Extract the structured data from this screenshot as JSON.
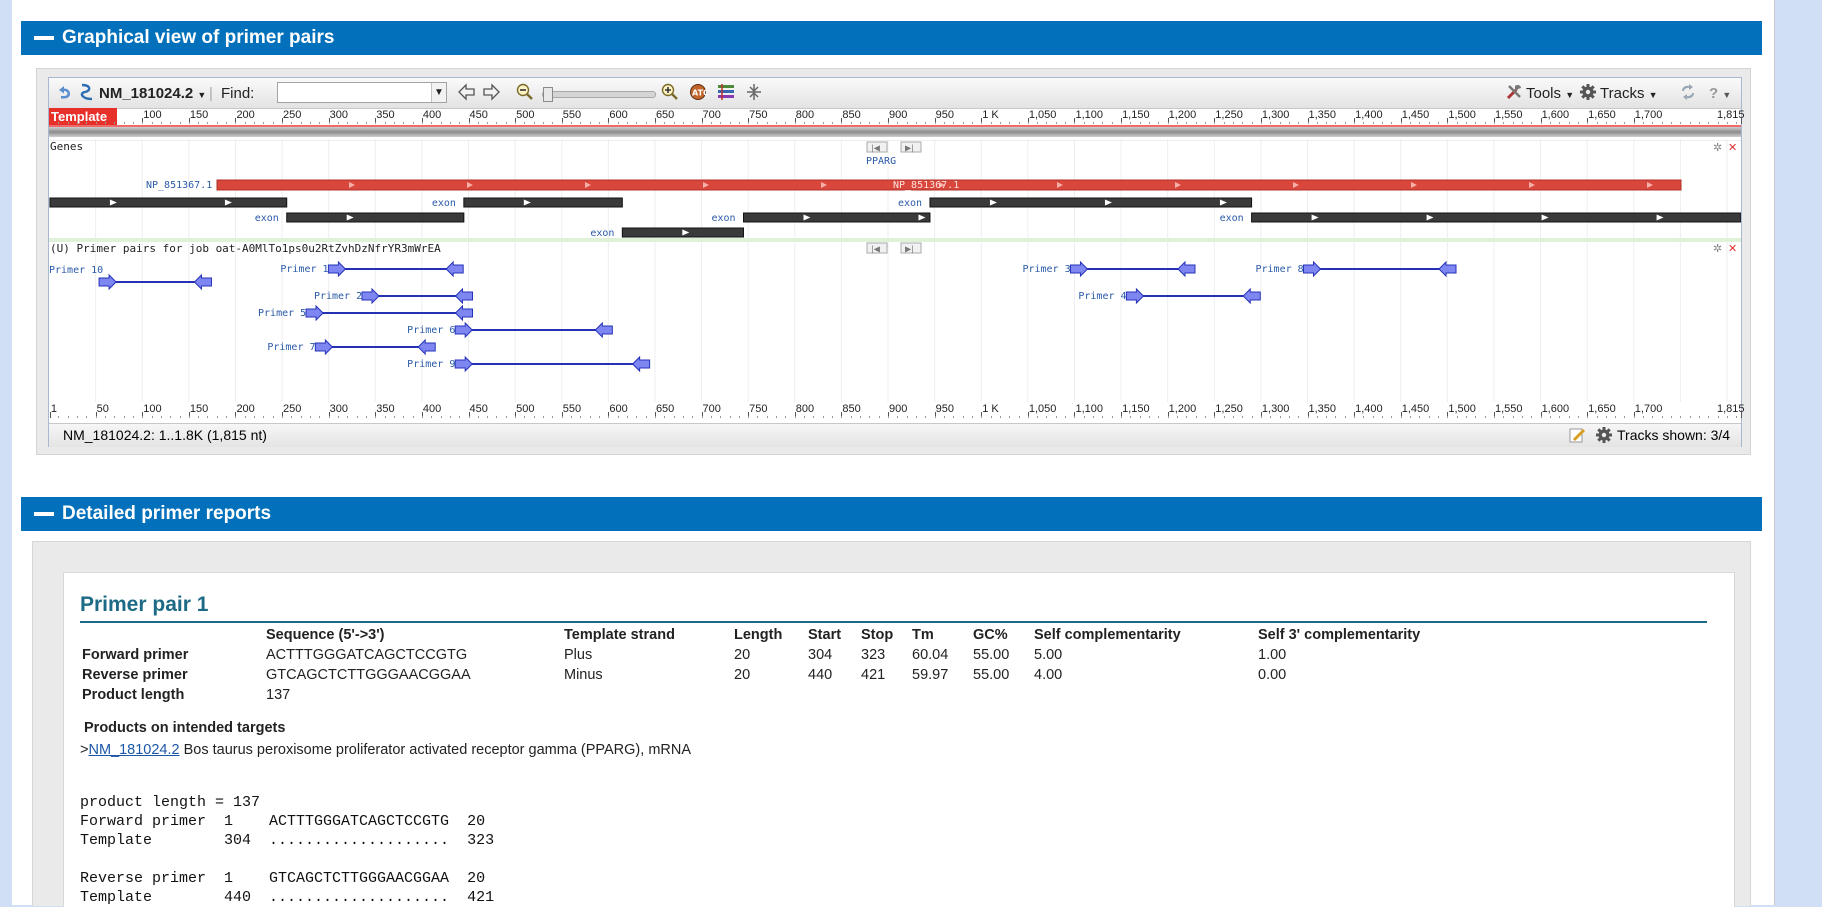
{
  "sections": {
    "graphical_title": "Graphical view of primer pairs",
    "detailed_title": "Detailed primer reports"
  },
  "toolbar": {
    "accession": "NM_181024.2",
    "find_label": "Find:",
    "find_value": "",
    "tools_label": "Tools",
    "tracks_label": "Tracks",
    "help_label": "?"
  },
  "ruler": {
    "template_label": "Template",
    "top_ticks": [
      "100",
      "150",
      "200",
      "250",
      "300",
      "350",
      "400",
      "450",
      "500",
      "550",
      "600",
      "650",
      "700",
      "750",
      "800",
      "850",
      "900",
      "950",
      "1 K",
      "1,050",
      "1,100",
      "1,150",
      "1,200",
      "1,250",
      "1,300",
      "1,350",
      "1,400",
      "1,450",
      "1,500",
      "1,550",
      "1,600",
      "1,650",
      "1,700",
      "1,815"
    ],
    "bottom_ticks": [
      "1",
      "50",
      "100",
      "150",
      "200",
      "250",
      "300",
      "350",
      "400",
      "450",
      "500",
      "550",
      "600",
      "650",
      "700",
      "750",
      "800",
      "850",
      "900",
      "950",
      "1 K",
      "1,050",
      "1,100",
      "1,150",
      "1,200",
      "1,250",
      "1,300",
      "1,350",
      "1,400",
      "1,450",
      "1,500",
      "1,550",
      "1,600",
      "1,650",
      "1,700",
      "1,815"
    ]
  },
  "genes_track": {
    "title": "Genes",
    "gene_label": "PPARG",
    "protein_label": "NP_851367.1",
    "protein_inner_label": "NP_851367.1",
    "exon_label": "exon"
  },
  "primer_track": {
    "title": "(U) Primer pairs for job oat-A0MlTo1ps0u2RtZvhDzNfrYR3mWrEA",
    "primers": [
      {
        "name": "Primer 10",
        "start": 58,
        "end": 170
      },
      {
        "name": "Primer 1",
        "start": 304,
        "end": 440
      },
      {
        "name": "Primer 2",
        "start": 340,
        "end": 450
      },
      {
        "name": "Primer 5",
        "start": 280,
        "end": 450
      },
      {
        "name": "Primer 6",
        "start": 440,
        "end": 600
      },
      {
        "name": "Primer 7",
        "start": 290,
        "end": 410
      },
      {
        "name": "Primer 9",
        "start": 440,
        "end": 640
      },
      {
        "name": "Primer 3",
        "start": 1100,
        "end": 1225
      },
      {
        "name": "Primer 4",
        "start": 1160,
        "end": 1295
      },
      {
        "name": "Primer 8",
        "start": 1350,
        "end": 1505
      }
    ]
  },
  "status": {
    "range_text": "NM_181024.2: 1..1.8K (1,815 nt)",
    "tracks_shown": "Tracks shown: 3/4"
  },
  "report": {
    "pair_title": "Primer pair 1",
    "headers": [
      "Sequence (5'->3')",
      "Template strand",
      "Length",
      "Start",
      "Stop",
      "Tm",
      "GC%",
      "Self complementarity",
      "Self 3' complementarity"
    ],
    "rows": [
      {
        "label": "Forward primer",
        "seq": "ACTTTGGGATCAGCTCCGTG",
        "strand": "Plus",
        "length": "20",
        "start": "304",
        "stop": "323",
        "tm": "60.04",
        "gc": "55.00",
        "self": "5.00",
        "self3": "1.00"
      },
      {
        "label": "Reverse primer",
        "seq": "GTCAGCTCTTGGGAACGGAA",
        "strand": "Minus",
        "length": "20",
        "start": "440",
        "stop": "421",
        "tm": "59.97",
        "gc": "55.00",
        "self": "4.00",
        "self3": "0.00"
      }
    ],
    "product_length_label": "Product length",
    "product_length": "137",
    "targets_heading": "Products on intended targets",
    "target_prefix": ">",
    "target_accession": "NM_181024.2",
    "target_description": "Bos taurus peroxisome proliferator activated receptor gamma (PPARG), mRNA",
    "alignment": [
      "product length = 137",
      "Forward primer  1    ACTTTGGGATCAGCTCCGTG  20",
      "Template        304  ....................  323",
      "",
      "Reverse primer  1    GTCAGCTCTTGGGAACGGAA  20",
      "Template        440  ....................  421"
    ]
  }
}
